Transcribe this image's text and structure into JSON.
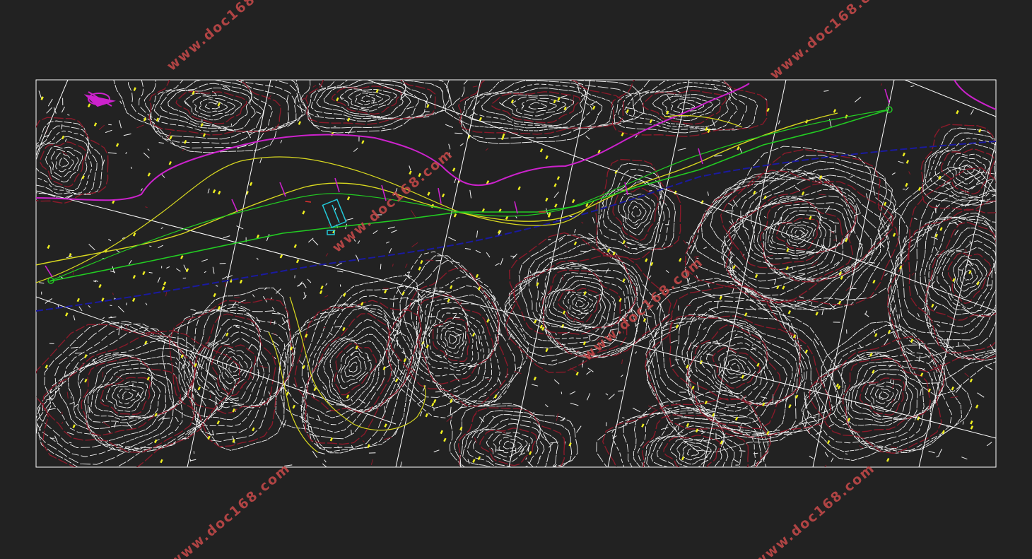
{
  "drawing": {
    "background": "#222222",
    "frame_color": "#ffffff",
    "colors": {
      "contour": "#f2f2f2",
      "contour_index": "#8a1a2a",
      "boundary": "#cc22cc",
      "alignment": "#22cc22",
      "road": "#d8d820",
      "river": "#1a1aa0",
      "structure": "#22c8d8",
      "elevation_points": "#f0f020"
    },
    "icons": [
      "north-arrow-icon"
    ]
  },
  "watermarks": [
    {
      "text": "www.doc168.com"
    },
    {
      "text": "www.doc168.com"
    },
    {
      "text": "www.doc168.com"
    },
    {
      "text": "www.doc168.com"
    },
    {
      "text": "www.doc168.com"
    },
    {
      "text": "www.doc168.com"
    }
  ]
}
